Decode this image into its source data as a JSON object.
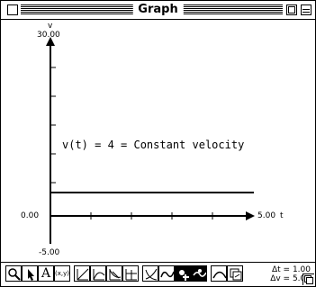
{
  "window": {
    "title": "Graph"
  },
  "axes": {
    "y_label": "v",
    "y_max": "30.00",
    "y_zero": "0.00",
    "y_min": "-5.00",
    "x_max": "5.00",
    "x_label": "t"
  },
  "equation": "v(t) = 4 = Constant velocity",
  "graph": {
    "y_range": [
      -5,
      30
    ],
    "x_range": [
      0,
      5
    ],
    "function_value": 4
  },
  "toolbar": {
    "tools": [
      {
        "name": "magnify-tool",
        "label": ""
      },
      {
        "name": "arrow-tool",
        "label": ""
      },
      {
        "name": "text-tool",
        "label": "A"
      },
      {
        "name": "xy-readout-tool",
        "label": "(x,y)"
      },
      {
        "name": "line-tool",
        "label": ""
      },
      {
        "name": "curve-tool",
        "label": ""
      },
      {
        "name": "slope-tool",
        "label": ""
      },
      {
        "name": "area-tool",
        "label": ""
      },
      {
        "name": "derivative-tool",
        "label": ""
      },
      {
        "name": "wave-tool",
        "label": ""
      },
      {
        "name": "point-add-tool",
        "label": ""
      },
      {
        "name": "point-move-tool",
        "label": ""
      },
      {
        "name": "smooth-curve-tool",
        "label": ""
      },
      {
        "name": "copy-graph-tool",
        "label": ""
      }
    ],
    "delta_t": "Δt = 1.00",
    "delta_v": "Δv = 5.00"
  }
}
